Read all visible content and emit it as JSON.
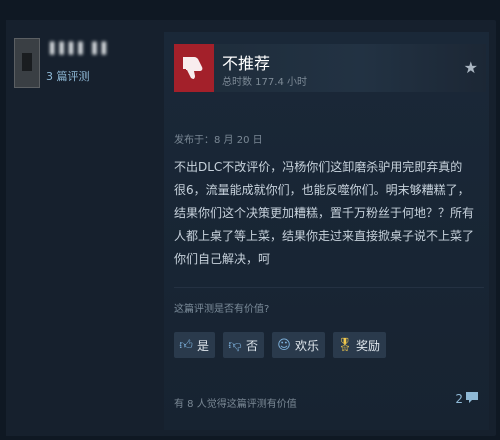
{
  "user": {
    "name": "▌▌▌▌ ▌▌",
    "review_count": "3 篇评测"
  },
  "review": {
    "recommendation": "不推荐",
    "hours": "总时数 177.4 小时",
    "posted": "发布于：8 月 20 日",
    "body": "不出DLC不改评价，冯杨你们这卸磨杀驴用完即弃真的很6，流量能成就你们，也能反噬你们。明末够糟糕了，结果你们这个决策更加糟糕，置千万粉丝于何地？？所有人都上桌了等上菜，结果你走过来直接掀桌子说不上菜了你们自己解决，呵",
    "helpful_question": "这篇评测是否有价值?",
    "found_helpful": "有 8 人觉得这篇评测有价值",
    "comment_count": "2"
  },
  "buttons": {
    "yes": "是",
    "no": "否",
    "funny": "欢乐",
    "award": "奖励"
  },
  "colors": {
    "thumb_down_bg": "#a3202a",
    "link": "#8fb9d6",
    "award_icon": "#f2c94c"
  }
}
